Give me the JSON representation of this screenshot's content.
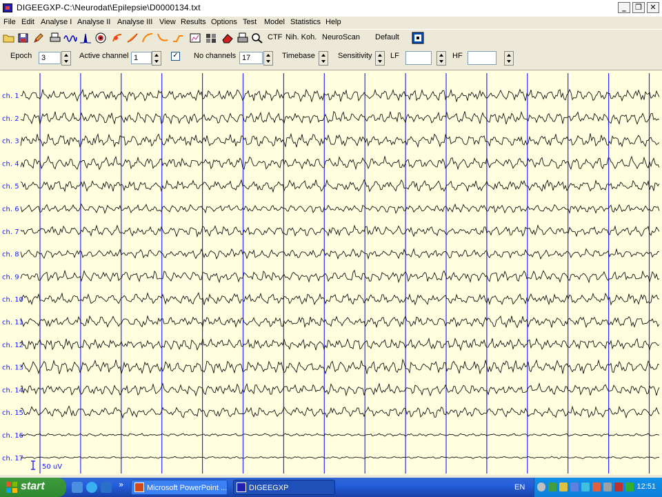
{
  "window": {
    "title": "DIGEEGXP-C:\\Neurodat\\Epilepsie\\D0000134.txt",
    "minimize_symbol": "_",
    "restore_symbol": "❐",
    "close_symbol": "✕"
  },
  "menu": [
    "File",
    "Edit",
    "Analyse I",
    "Analyse II",
    "Analyse III",
    "View",
    "Results",
    "Options",
    "Test",
    "Model",
    "Statistics",
    "Help"
  ],
  "toolbar": {
    "icons": [
      "open-folder-icon",
      "save-disk-icon",
      "edit-pencil-icon",
      "print-icon",
      "wave-icon",
      "spectrum-icon",
      "brain-map-icon",
      "filter-icon",
      "trend-icon",
      "curve-icon",
      "curve-orange-icon",
      "lowpass-icon",
      "histogram-icon",
      "puzzle-icon",
      "erase-icon",
      "print2-icon",
      "zoom-icon"
    ],
    "text_buttons": [
      "CTF",
      "Nih. Koh.",
      "NeuroScan",
      "Default"
    ],
    "frame_button_icon": "target-frame-icon"
  },
  "params": {
    "epoch_label": "Epoch",
    "epoch_value": "3",
    "active_channel_label": "Active channel",
    "active_channel_value": "1",
    "checkbox_mark": "✓",
    "no_channels_label": "No channels",
    "no_channels_value": "17",
    "timebase_label": "Timebase",
    "sensitivity_label": "Sensitivity",
    "lf_label": "LF",
    "lf_value": "",
    "hf_label": "HF",
    "hf_value": ""
  },
  "eeg": {
    "channels": [
      "ch. 1",
      "ch. 2",
      "ch. 3",
      "ch. 4",
      "ch. 5",
      "ch. 6",
      "ch. 7",
      "ch. 8",
      "ch. 9",
      "ch. 10",
      "ch. 11",
      "ch. 12",
      "ch. 13",
      "ch. 14",
      "ch. 15",
      "ch. 16",
      "ch. 17"
    ],
    "scale_label": "50 uV",
    "second_markers": 16,
    "background_color": "#ffffe0",
    "grid_color": "#2a2aff",
    "label_color": "#1a1aff"
  },
  "taskbar": {
    "start_label": "start",
    "tasks": [
      {
        "label": "Microsoft PowerPoint ...",
        "icon": "powerpoint-icon"
      },
      {
        "label": "DIGEEGXP",
        "icon": "digeeg-app-icon"
      }
    ],
    "more_symbol": "»",
    "lang": "EN",
    "clock": "12:51"
  }
}
